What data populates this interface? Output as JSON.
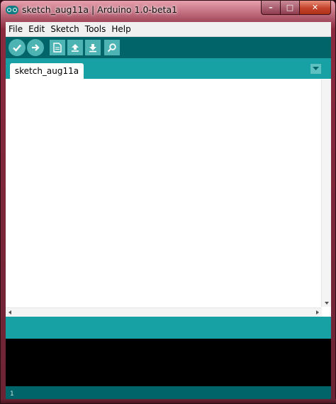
{
  "window": {
    "title": "sketch_aug11a | Arduino 1.0-beta1",
    "controls": {
      "minimize": "–",
      "maximize": "□",
      "close": "✕"
    }
  },
  "menubar": {
    "items": [
      "File",
      "Edit",
      "Sketch",
      "Tools",
      "Help"
    ]
  },
  "toolbar": {
    "buttons": [
      {
        "name": "verify",
        "icon": "checkmark-icon"
      },
      {
        "name": "upload",
        "icon": "right-arrow-icon"
      },
      {
        "name": "new",
        "icon": "new-document-icon"
      },
      {
        "name": "open",
        "icon": "up-arrow-icon"
      },
      {
        "name": "save",
        "icon": "down-arrow-icon"
      },
      {
        "name": "serial-monitor",
        "icon": "magnifier-icon"
      }
    ]
  },
  "tabs": [
    {
      "label": "sketch_aug11a",
      "active": true
    }
  ],
  "editor": {
    "content": ""
  },
  "console": {
    "text": ""
  },
  "footer": {
    "line_number": "1"
  },
  "colors": {
    "toolbar_bg": "#006468",
    "tabbar_bg": "#17a1a5",
    "button_bg": "#4db3b3",
    "console_bg": "#000000"
  }
}
